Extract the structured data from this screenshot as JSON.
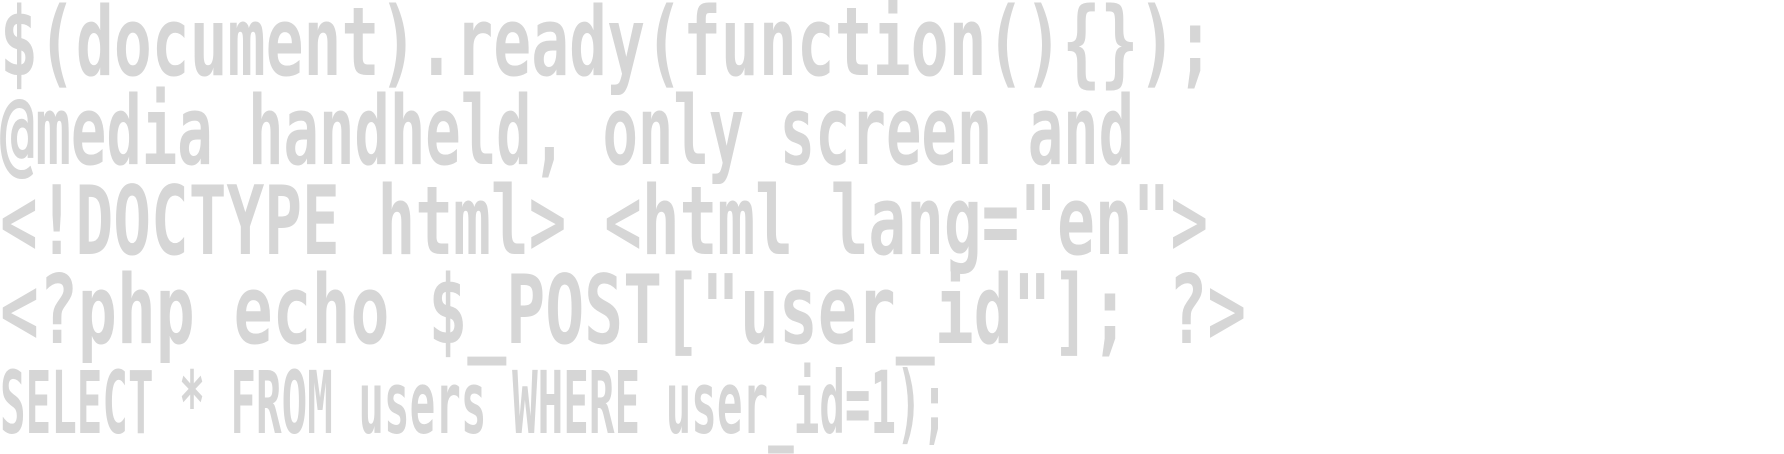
{
  "colors": {
    "text": "#d6d6d6",
    "background": "#ffffff"
  },
  "lines": [
    "$(document).ready(function(){});",
    "@media handheld, only screen and",
    "<!DOCTYPE html> <html lang=\"en\">",
    "<?php echo $_POST[\"user_id\"]; ?>",
    "SELECT * FROM users WHERE user_id=1);"
  ]
}
